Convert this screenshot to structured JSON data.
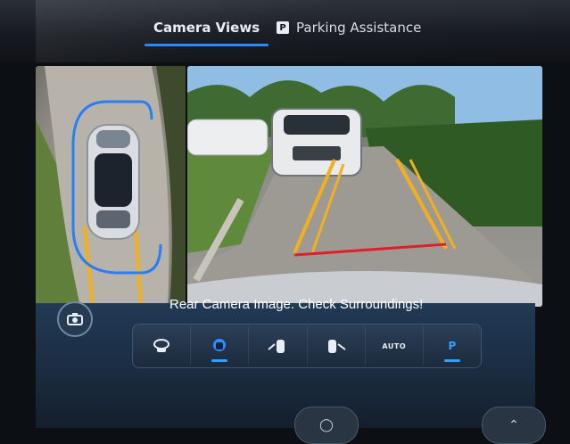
{
  "tabs": {
    "camera_views": "Camera Views",
    "parking_assistance": "Parking Assistance",
    "parking_badge": "P"
  },
  "message": "Rear Camera Image. Check Surroundings!",
  "toolbar": {
    "items": [
      {
        "icon": "rear-camera-icon"
      },
      {
        "icon": "top-view-camera-icon"
      },
      {
        "icon": "car-left-icon"
      },
      {
        "icon": "car-right-icon"
      },
      {
        "icon": "auto-icon",
        "label": "AUTO"
      },
      {
        "icon": "park-assist-icon",
        "label": "P"
      }
    ]
  },
  "colors": {
    "accent": "#2a8bff",
    "guide_line": "#f2b01e",
    "stop_line": "#e21d2a",
    "panel": "#1c3047"
  }
}
